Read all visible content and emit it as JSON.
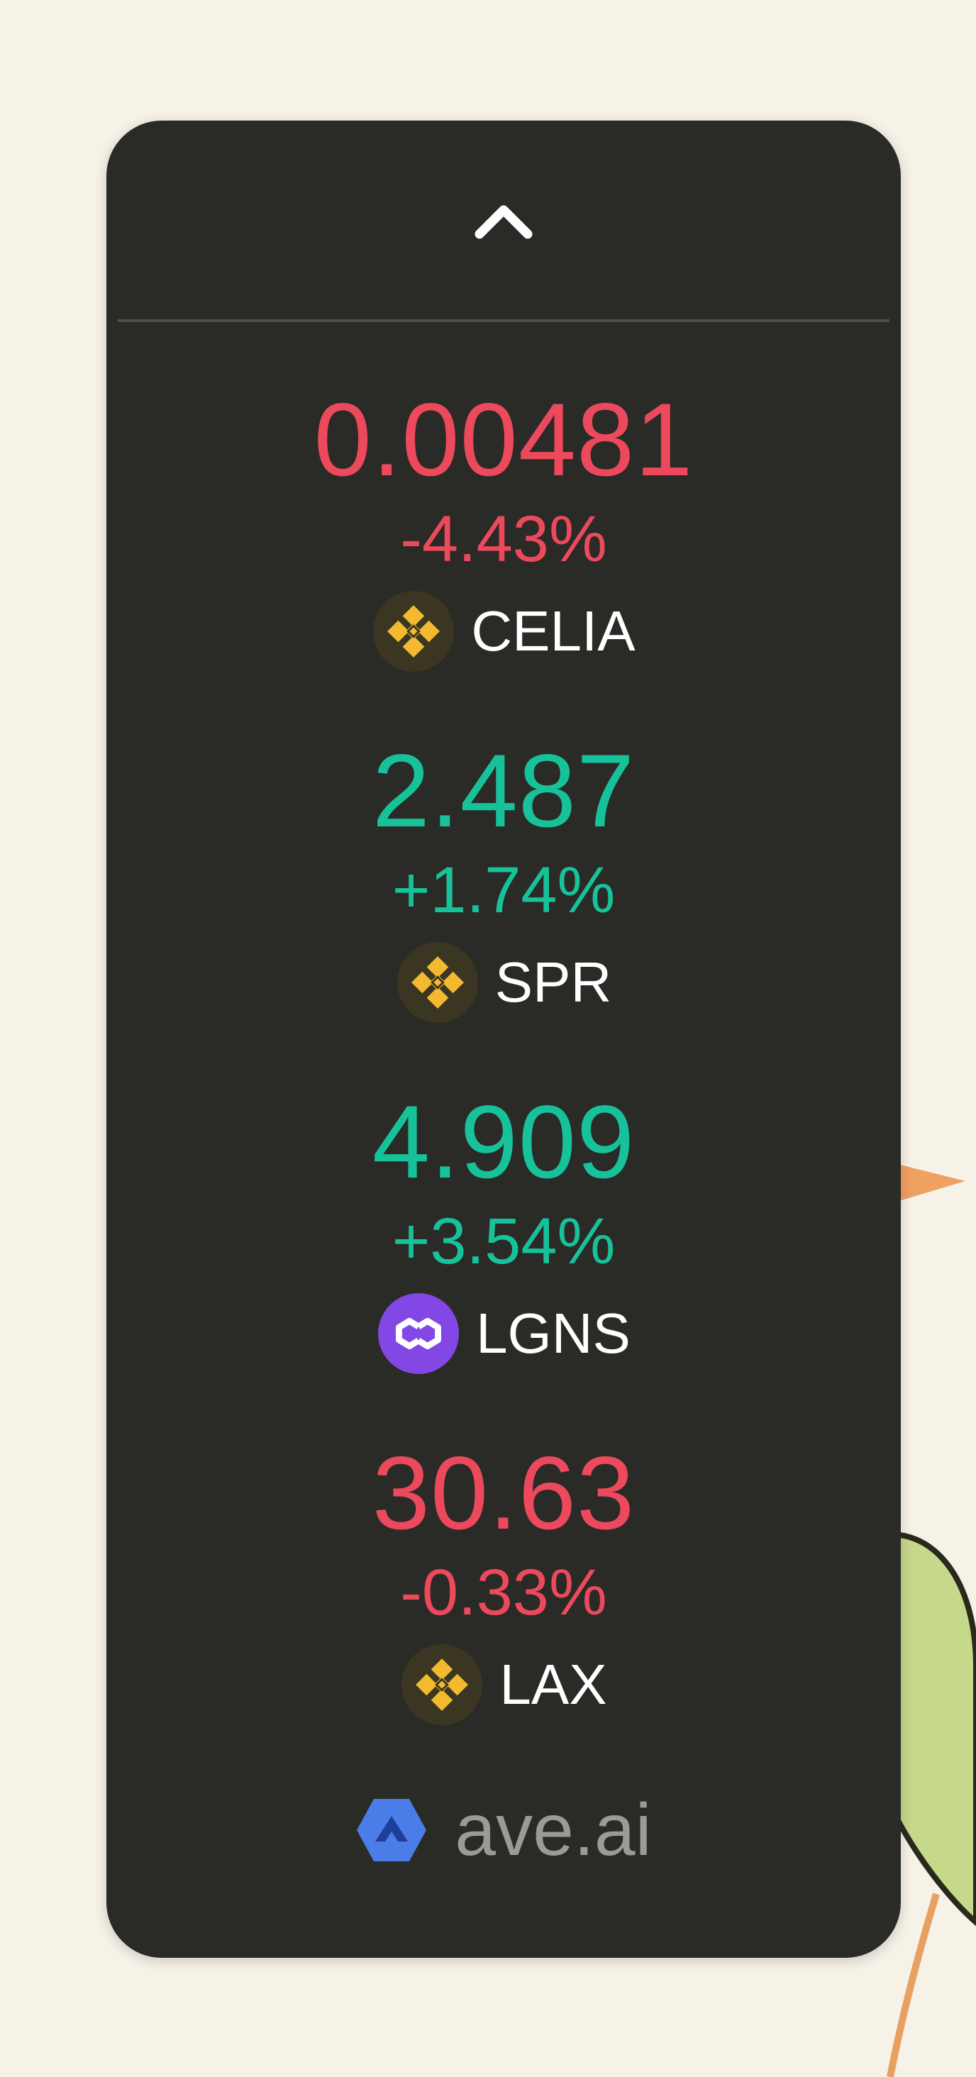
{
  "widget": {
    "collapse_icon": "chevron-up-icon",
    "colors": {
      "background": "#2a2a27",
      "negative": "#ec4a5c",
      "positive": "#17c29a",
      "divider": "#4e4e4a"
    },
    "tickers": [
      {
        "price": "0.00481",
        "change": "-4.43%",
        "direction": "down",
        "symbol": "CELIA",
        "chain_icon": "bnb-chain-icon"
      },
      {
        "price": "2.487",
        "change": "+1.74%",
        "direction": "up",
        "symbol": "SPR",
        "chain_icon": "bnb-chain-icon"
      },
      {
        "price": "4.909",
        "change": "+3.54%",
        "direction": "up",
        "symbol": "LGNS",
        "chain_icon": "polygon-chain-icon"
      },
      {
        "price": "30.63",
        "change": "-0.33%",
        "direction": "down",
        "symbol": "LAX",
        "chain_icon": "bnb-chain-icon"
      }
    ],
    "brand": {
      "name": "ave.ai",
      "logo_icon": "ave-logo-icon"
    }
  }
}
